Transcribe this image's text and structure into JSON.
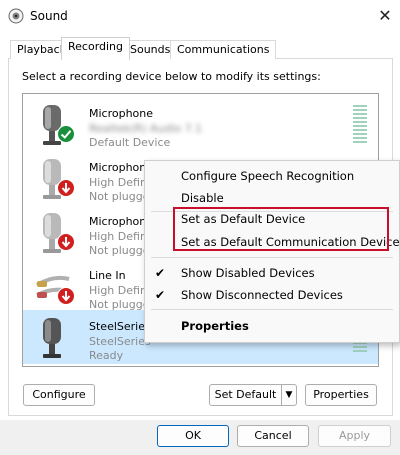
{
  "window": {
    "title": "Sound",
    "close_glyph": "✕",
    "icon": "speaker-icon"
  },
  "tabs": [
    {
      "label": "Playback",
      "active": false
    },
    {
      "label": "Recording",
      "active": true
    },
    {
      "label": "Sounds",
      "active": false
    },
    {
      "label": "Communications",
      "active": false
    }
  ],
  "instruction": "Select a recording device below to modify its settings:",
  "devices": [
    {
      "name": "Microphone",
      "sub": "Realtek(R) Audio 7.1",
      "status": "Default Device",
      "icon": "microphone-icon",
      "badge": "check-badge-icon"
    },
    {
      "name": "Microphone",
      "sub": "High Defin",
      "status": "Not plugge",
      "icon": "microphone-icon",
      "badge": "down-arrow-badge-icon"
    },
    {
      "name": "Microphone",
      "sub": "High Defin",
      "status": "Not plugge",
      "icon": "microphone-icon",
      "badge": "down-arrow-badge-icon"
    },
    {
      "name": "Line In",
      "sub": "High Defin",
      "status": "Not plugge",
      "icon": "line-in-cable-icon",
      "badge": "down-arrow-badge-icon"
    },
    {
      "name": "SteelSeries",
      "sub": "SteelSeries",
      "status": "Ready",
      "icon": "microphone-icon",
      "badge": "",
      "selected": true
    }
  ],
  "context_menu": {
    "items": [
      {
        "label": "Configure Speech Recognition",
        "checked": false,
        "bold": false
      },
      {
        "label": "Disable",
        "checked": false,
        "bold": false
      },
      {
        "label": "Set as Default Device",
        "checked": false,
        "bold": false
      },
      {
        "label": "Set as Default Communication Device",
        "checked": false,
        "bold": false
      },
      {
        "label": "Show Disabled Devices",
        "checked": true,
        "bold": false
      },
      {
        "label": "Show Disconnected Devices",
        "checked": true,
        "bold": false
      },
      {
        "label": "Properties",
        "checked": false,
        "bold": true
      }
    ],
    "check_glyph": "✔"
  },
  "buttons": {
    "configure": "Configure",
    "set_default": "Set Default",
    "set_default_arrow": "▼",
    "properties": "Properties",
    "ok": "OK",
    "cancel": "Cancel",
    "apply": "Apply"
  },
  "colors": {
    "selection": "#cce8ff",
    "check_green": "#1a8f3c",
    "badge_red": "#d11f1f",
    "highlight_red": "#c8102e",
    "level_green": "#9fd3bf"
  }
}
